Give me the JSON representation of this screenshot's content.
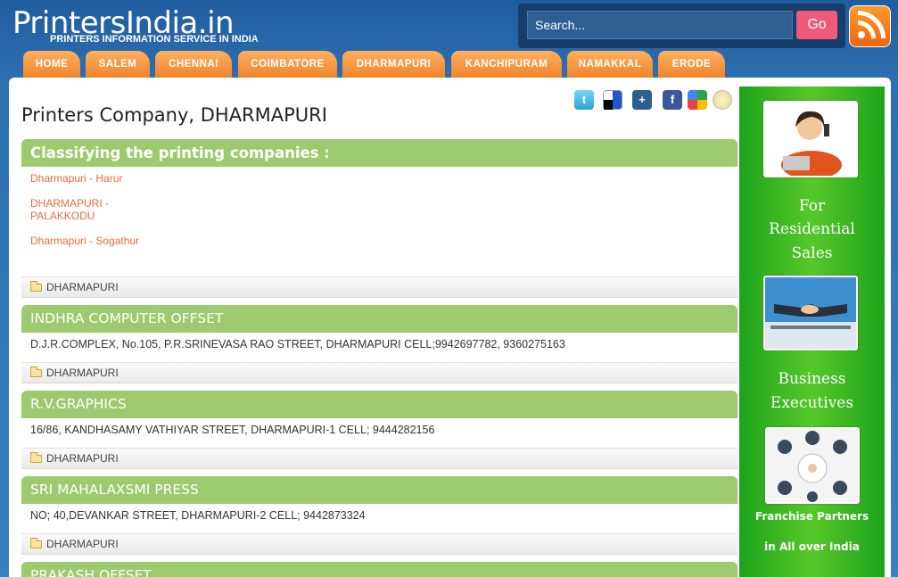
{
  "header": {
    "logo": "PrintersIndia.in",
    "tagline": "PRINTERS INFORMATION SERVICE IN INDIA",
    "search_placeholder": "Search...",
    "go_label": "Go"
  },
  "nav": [
    "HOME",
    "SALEM",
    "CHENNAI",
    "COIMBATORE",
    "DHARMAPURI",
    "KANCHIPURAM",
    "NAMAKKAL",
    "ERODE"
  ],
  "page": {
    "title": "Printers Company, DHARMAPURI",
    "classify_heading": "Classifying the printing companies :",
    "category_links": [
      "Dharmapuri - Harur",
      "DHARMAPURI -\nPALAKKODU",
      "Dharmapuri - Sogathur"
    ],
    "category_footer": "DHARMAPURI"
  },
  "companies": [
    {
      "name": "INDHRA COMPUTER OFFSET",
      "address": "D.J.R.COMPLEX, No.105, P.R.SRINEVASA RAO STREET, DHARMAPURI CELL;9942697782, 9360275163",
      "category": "DHARMAPURI"
    },
    {
      "name": "R.V.GRAPHICS",
      "address": "16/86, KANDHASAMY VATHIYAR STREET, DHARMAPURI-1 CELL; 9444282156",
      "category": "DHARMAPURI"
    },
    {
      "name": "SRI MAHALAXSMI PRESS",
      "address": "NO; 40,DEVANKAR STREET, DHARMAPURI-2 CELL; 9442873324",
      "category": "DHARMAPURI"
    },
    {
      "name": "PRAKASH OFFSET",
      "address": "",
      "category": ""
    }
  ],
  "sidebar": {
    "residential_line1": "For",
    "residential_line2": "Residential",
    "residential_line3": "Sales",
    "business_line1": "Business",
    "business_line2": "Executives",
    "franchise_line1": "Franchise Partners",
    "franchise_line2": "in All over India"
  },
  "colors": {
    "nav_tab": "#f0832a",
    "section_head": "#9dca6f",
    "link": "#ec6a3a",
    "sidebar": "#3ab520"
  }
}
